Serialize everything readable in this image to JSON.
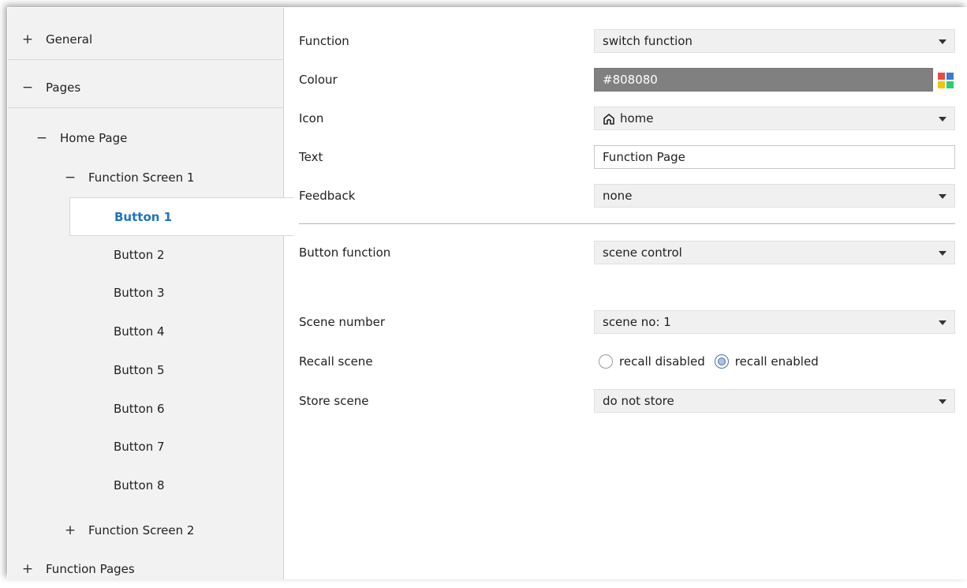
{
  "sidebar": {
    "general": {
      "sign": "+",
      "label": "General"
    },
    "pages": {
      "sign": "−",
      "label": "Pages"
    },
    "home_page": {
      "sign": "−",
      "label": "Home Page"
    },
    "function_screen_1": {
      "sign": "−",
      "label": "Function Screen 1"
    },
    "buttons": [
      "Button 1",
      "Button 2",
      "Button 3",
      "Button 4",
      "Button 5",
      "Button 6",
      "Button 7",
      "Button 8"
    ],
    "function_screen_2": {
      "sign": "+",
      "label": "Function Screen 2"
    },
    "function_pages": {
      "sign": "+",
      "label": "Function Pages"
    }
  },
  "form": {
    "function": {
      "label": "Function",
      "value": "switch function"
    },
    "colour": {
      "label": "Colour",
      "value": "#808080"
    },
    "icon": {
      "label": "Icon",
      "value": "home",
      "icon_name": "home-icon"
    },
    "text": {
      "label": "Text",
      "value": "Function Page"
    },
    "feedback": {
      "label": "Feedback",
      "value": "none"
    },
    "button_function": {
      "label": "Button function",
      "value": "scene control"
    },
    "scene_number": {
      "label": "Scene number",
      "value": "scene no: 1"
    },
    "recall_scene": {
      "label": "Recall scene",
      "options": [
        "recall disabled",
        "recall enabled"
      ],
      "selected": "recall enabled"
    },
    "store_scene": {
      "label": "Store scene",
      "value": "do not store"
    }
  },
  "colors": {
    "accent": "#1e73be",
    "sidebar_bg": "#f2f2f2",
    "colour_swatch": "#808080",
    "palette": [
      "#e74c3c",
      "#3a7bd5",
      "#f1c40f",
      "#2ecc71"
    ]
  }
}
